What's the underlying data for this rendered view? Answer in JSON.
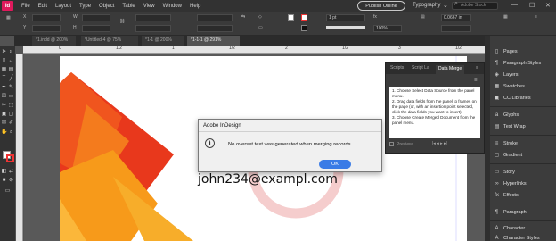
{
  "menubar": {
    "logo": "Id",
    "items": [
      "File",
      "Edit",
      "Layout",
      "Type",
      "Object",
      "Table",
      "View",
      "Window",
      "Help"
    ],
    "publish_label": "Publish Online",
    "workspace": "Typography",
    "search_placeholder": "Adobe Stock"
  },
  "control": {
    "stroke_weight": "1 pt",
    "zoom": "100%",
    "measure": "0.0667 in"
  },
  "tabs": [
    {
      "label": "*1.indd @ 200%"
    },
    {
      "label": "*Untitled-4 @ 75%"
    },
    {
      "label": "*1-1 @ 200%"
    },
    {
      "label": "*1-1-1 @ 291%"
    }
  ],
  "ruler": {
    "marks": [
      "0",
      "1/2",
      "1",
      "1/2",
      "2",
      "1/2",
      "3",
      "1/2"
    ]
  },
  "float_panel": {
    "tabs": [
      "Scripts",
      "Script La",
      "Data Merge"
    ],
    "instructions": "1. Choose Select Data Source from the panel menu.\n2. Drag data fields from the panel to frames on the page (or, with an insertion point selected, click the data fields you want to insert).\n3. Choose Create Merged Document from the panel menu.",
    "preview_label": "Preview"
  },
  "dialog": {
    "title": "Adobe InDesign",
    "message": "No overset text was generated when merging records.",
    "ok_label": "OK"
  },
  "document_text": "john234@exampl.com",
  "dock": {
    "items": [
      "Pages",
      "Paragraph Styles",
      "Layers",
      "Swatches",
      "CC Libraries",
      "Glyphs",
      "Text Wrap",
      "Stroke",
      "Gradient",
      "Story",
      "Hyperlinks",
      "Effects",
      "Paragraph",
      "Character",
      "Character Styles"
    ]
  },
  "colors": {
    "accent": "#e0195c",
    "ok_button": "#3a7be6",
    "shape_red": "#e8381c",
    "shape_orange": "#f79a1a"
  }
}
